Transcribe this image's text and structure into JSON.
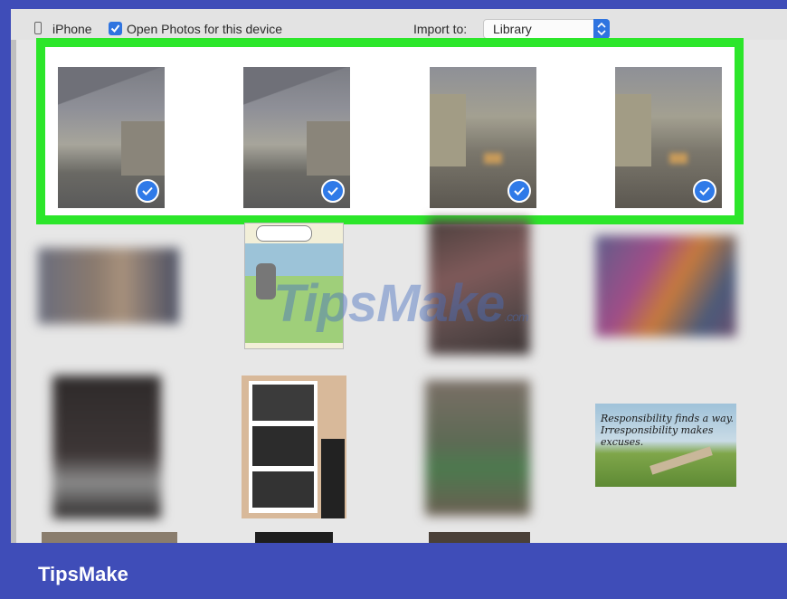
{
  "toolbar": {
    "device_label": "iPhone",
    "open_photos_label": "Open Photos for this device",
    "import_to_label": "Import to:",
    "import_destination": "Library"
  },
  "grid": {
    "quote_text": "Responsibility finds a way. Irresponsibility makes excuses."
  },
  "watermark": {
    "main": "TipsMake",
    "suffix": ".com"
  },
  "footer": {
    "brand": "TipsMake"
  },
  "colors": {
    "highlight": "#2ce62a",
    "accent": "#2f7ae8",
    "brand_bar": "#3f4db8"
  }
}
